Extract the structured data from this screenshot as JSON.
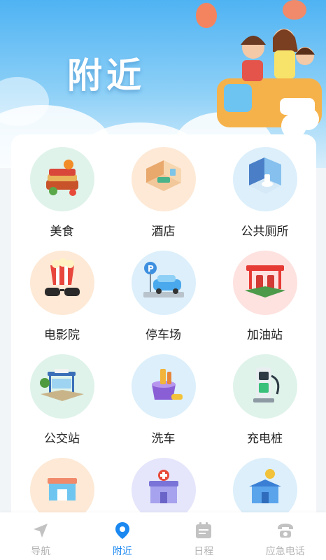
{
  "header": {
    "title": "附近"
  },
  "categories": [
    {
      "label": "美食",
      "icon": "food-icon",
      "bg": "#dff3ea"
    },
    {
      "label": "酒店",
      "icon": "hotel-icon",
      "bg": "#fde9d6"
    },
    {
      "label": "公共厕所",
      "icon": "restroom-icon",
      "bg": "#dceffb"
    },
    {
      "label": "电影院",
      "icon": "cinema-icon",
      "bg": "#fde9d6"
    },
    {
      "label": "停车场",
      "icon": "parking-icon",
      "bg": "#dceffb"
    },
    {
      "label": "加油站",
      "icon": "gas-station-icon",
      "bg": "#fde2e0"
    },
    {
      "label": "公交站",
      "icon": "bus-stop-icon",
      "bg": "#dff3ea"
    },
    {
      "label": "洗车",
      "icon": "car-wash-icon",
      "bg": "#dceffb"
    },
    {
      "label": "充电桩",
      "icon": "charging-pile-icon",
      "bg": "#dff3ea"
    },
    {
      "label": "",
      "icon": "shop-icon",
      "bg": "#fde9d6"
    },
    {
      "label": "",
      "icon": "pharmacy-icon",
      "bg": "#e5e6fb"
    },
    {
      "label": "",
      "icon": "bank-icon",
      "bg": "#dceffb"
    }
  ],
  "tabbar": {
    "items": [
      {
        "label": "导航",
        "icon": "navigation-icon",
        "active": false
      },
      {
        "label": "附近",
        "icon": "location-pin-icon",
        "active": true
      },
      {
        "label": "日程",
        "icon": "calendar-icon",
        "active": false
      },
      {
        "label": "应急电话",
        "icon": "phone-icon",
        "active": false
      }
    ]
  },
  "colors": {
    "accent": "#1a88f0",
    "inactive": "#b3b3b3",
    "hero": "#4fb3f3"
  }
}
